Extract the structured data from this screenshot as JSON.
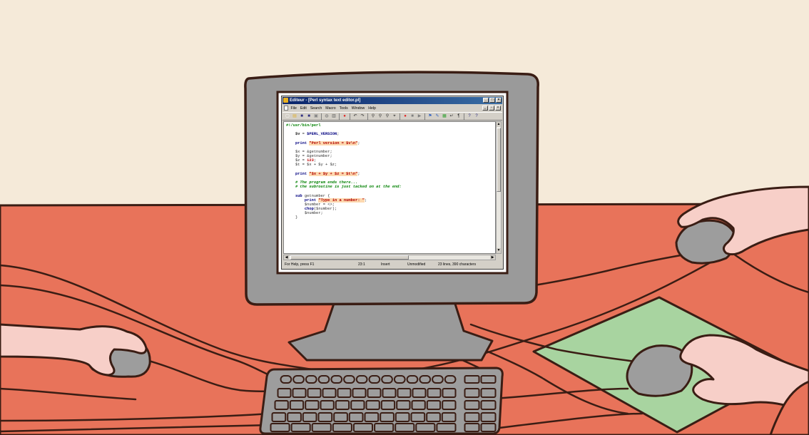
{
  "colors": {
    "wall": "#f5ead9",
    "desk": "#e8735a",
    "monitor": "#9a9a9a",
    "outline": "#3a1d14",
    "mousepad": "#a8d4a0",
    "skin": "#f7cfc8",
    "sleeve": "#e8735a",
    "device_gray": "#9d9d9d"
  },
  "editor": {
    "title": "Editeur - [Perl syntax text editor.pl]",
    "window_buttons": [
      "_",
      "□",
      "×"
    ],
    "menu": [
      "File",
      "Edit",
      "Search",
      "Macro",
      "Tools",
      "Window",
      "Help"
    ],
    "mdi_buttons": [
      "_",
      "▫",
      "×"
    ],
    "toolbar_icons": [
      {
        "name": "new-file-icon",
        "glyph": "▢",
        "color": "#ffffff"
      },
      {
        "name": "open-folder-icon",
        "glyph": "▤",
        "color": "#e0b030"
      },
      {
        "name": "save-icon",
        "glyph": "■",
        "color": "#303080"
      },
      {
        "name": "save-all-icon",
        "glyph": "■",
        "color": "#303080"
      },
      {
        "name": "close-file-icon",
        "glyph": "▣",
        "color": "#808080"
      },
      {
        "name": "print-preview-icon",
        "glyph": "◍",
        "color": "#707070"
      },
      {
        "name": "print-icon",
        "glyph": "▥",
        "color": "#606060"
      },
      {
        "name": "stop-icon",
        "glyph": "●",
        "color": "#e02020"
      },
      {
        "name": "undo-icon",
        "glyph": "↶",
        "color": "#303030"
      },
      {
        "name": "redo-icon",
        "glyph": "↷",
        "color": "#303030"
      },
      {
        "name": "find-icon",
        "glyph": "⚲",
        "color": "#303030"
      },
      {
        "name": "find-next-icon",
        "glyph": "⚲",
        "color": "#303030"
      },
      {
        "name": "replace-icon",
        "glyph": "⚲",
        "color": "#303030"
      },
      {
        "name": "goto-icon",
        "glyph": "⌖",
        "color": "#303030"
      },
      {
        "name": "record-macro-icon",
        "glyph": "●",
        "color": "#e02020"
      },
      {
        "name": "stop-macro-icon",
        "glyph": "■",
        "color": "#808080"
      },
      {
        "name": "play-macro-icon",
        "glyph": "▶",
        "color": "#808080"
      },
      {
        "name": "bookmark-icon",
        "glyph": "⚑",
        "color": "#3060c0"
      },
      {
        "name": "tools-icon",
        "glyph": "✎",
        "color": "#3060c0"
      },
      {
        "name": "compile-icon",
        "glyph": "▦",
        "color": "#30a030"
      },
      {
        "name": "word-wrap-icon",
        "glyph": "↵",
        "color": "#303030"
      },
      {
        "name": "pilcrow-icon",
        "glyph": "¶",
        "color": "#303030"
      },
      {
        "name": "context-help-icon",
        "glyph": "?",
        "color": "#303080"
      },
      {
        "name": "help-icon",
        "glyph": "?",
        "color": "#303080"
      }
    ],
    "code_lines": [
      [
        {
          "t": "#!/usr/bin/perl",
          "c": "shebang"
        }
      ],
      [],
      [
        {
          "t": "    "
        },
        {
          "t": "$v",
          "c": "var"
        },
        {
          "t": " = "
        },
        {
          "t": "$PERL_VERSION",
          "c": "kw"
        },
        {
          "t": ";"
        }
      ],
      [],
      [
        {
          "t": "    "
        },
        {
          "t": "print",
          "c": "kw"
        },
        {
          "t": " "
        },
        {
          "t": "\"Perl version = $v\\n\"",
          "c": "str"
        },
        {
          "t": ";"
        }
      ],
      [],
      [
        {
          "t": "    $x = &getnumber;"
        }
      ],
      [
        {
          "t": "    $y = &getnumber;"
        }
      ],
      [
        {
          "t": "    $z = "
        },
        {
          "t": "123",
          "c": "num"
        },
        {
          "t": ";"
        }
      ],
      [
        {
          "t": "    $t = $x + $y + $z;"
        }
      ],
      [],
      [
        {
          "t": "    "
        },
        {
          "t": "print",
          "c": "kw"
        },
        {
          "t": " "
        },
        {
          "t": "\"$x + $y + $z = $t\\n\"",
          "c": "str"
        },
        {
          "t": ";"
        }
      ],
      [],
      [
        {
          "t": "    "
        },
        {
          "t": "# The program ends there...",
          "c": "cmt"
        }
      ],
      [
        {
          "t": "    "
        },
        {
          "t": "# the subroutine is just tacked on at the end:",
          "c": "cmt"
        }
      ],
      [],
      [
        {
          "t": "    "
        },
        {
          "t": "sub",
          "c": "kw"
        },
        {
          "t": " getnumber {"
        }
      ],
      [
        {
          "t": "        "
        },
        {
          "t": "print",
          "c": "kw"
        },
        {
          "t": " "
        },
        {
          "t": "\"Type in a number: \"",
          "c": "str"
        },
        {
          "t": ";"
        }
      ],
      [
        {
          "t": "        $number = <>;"
        }
      ],
      [
        {
          "t": "        "
        },
        {
          "t": "chop",
          "c": "kw"
        },
        {
          "t": "($number);"
        }
      ],
      [
        {
          "t": "        $number;"
        }
      ],
      [
        {
          "t": "    }"
        }
      ]
    ],
    "status": {
      "help": "For Help, press F1",
      "position": "23:1",
      "mode": "Insert",
      "state": "Unmodified",
      "stats": "23 lines, 390 characters"
    }
  }
}
